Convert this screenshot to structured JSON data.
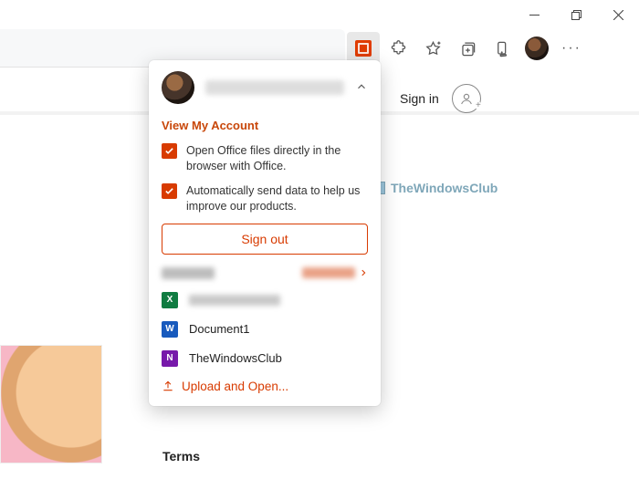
{
  "window": {
    "minimize": "Minimize",
    "restore": "Restore",
    "close": "Close"
  },
  "toolbar": {
    "office_ext": "Office extension",
    "extensions": "Extensions",
    "favorites": "Favorites",
    "collections": "Collections",
    "read_aloud": "Sync",
    "profile": "Profile",
    "more": "···"
  },
  "page": {
    "sign_in": "Sign in",
    "terms": "Terms",
    "watermark": "TheWindowsClub"
  },
  "panel": {
    "view_account": "View My Account",
    "opt1": "Open Office files directly in the browser with Office.",
    "opt2": "Automatically send data to help us improve our products.",
    "sign_out": "Sign out",
    "files": [
      {
        "app": "excel",
        "letter": "X",
        "name": ""
      },
      {
        "app": "word",
        "letter": "W",
        "name": "Document1"
      },
      {
        "app": "onenote",
        "letter": "N",
        "name": "TheWindowsClub"
      }
    ],
    "upload": "Upload and Open..."
  }
}
